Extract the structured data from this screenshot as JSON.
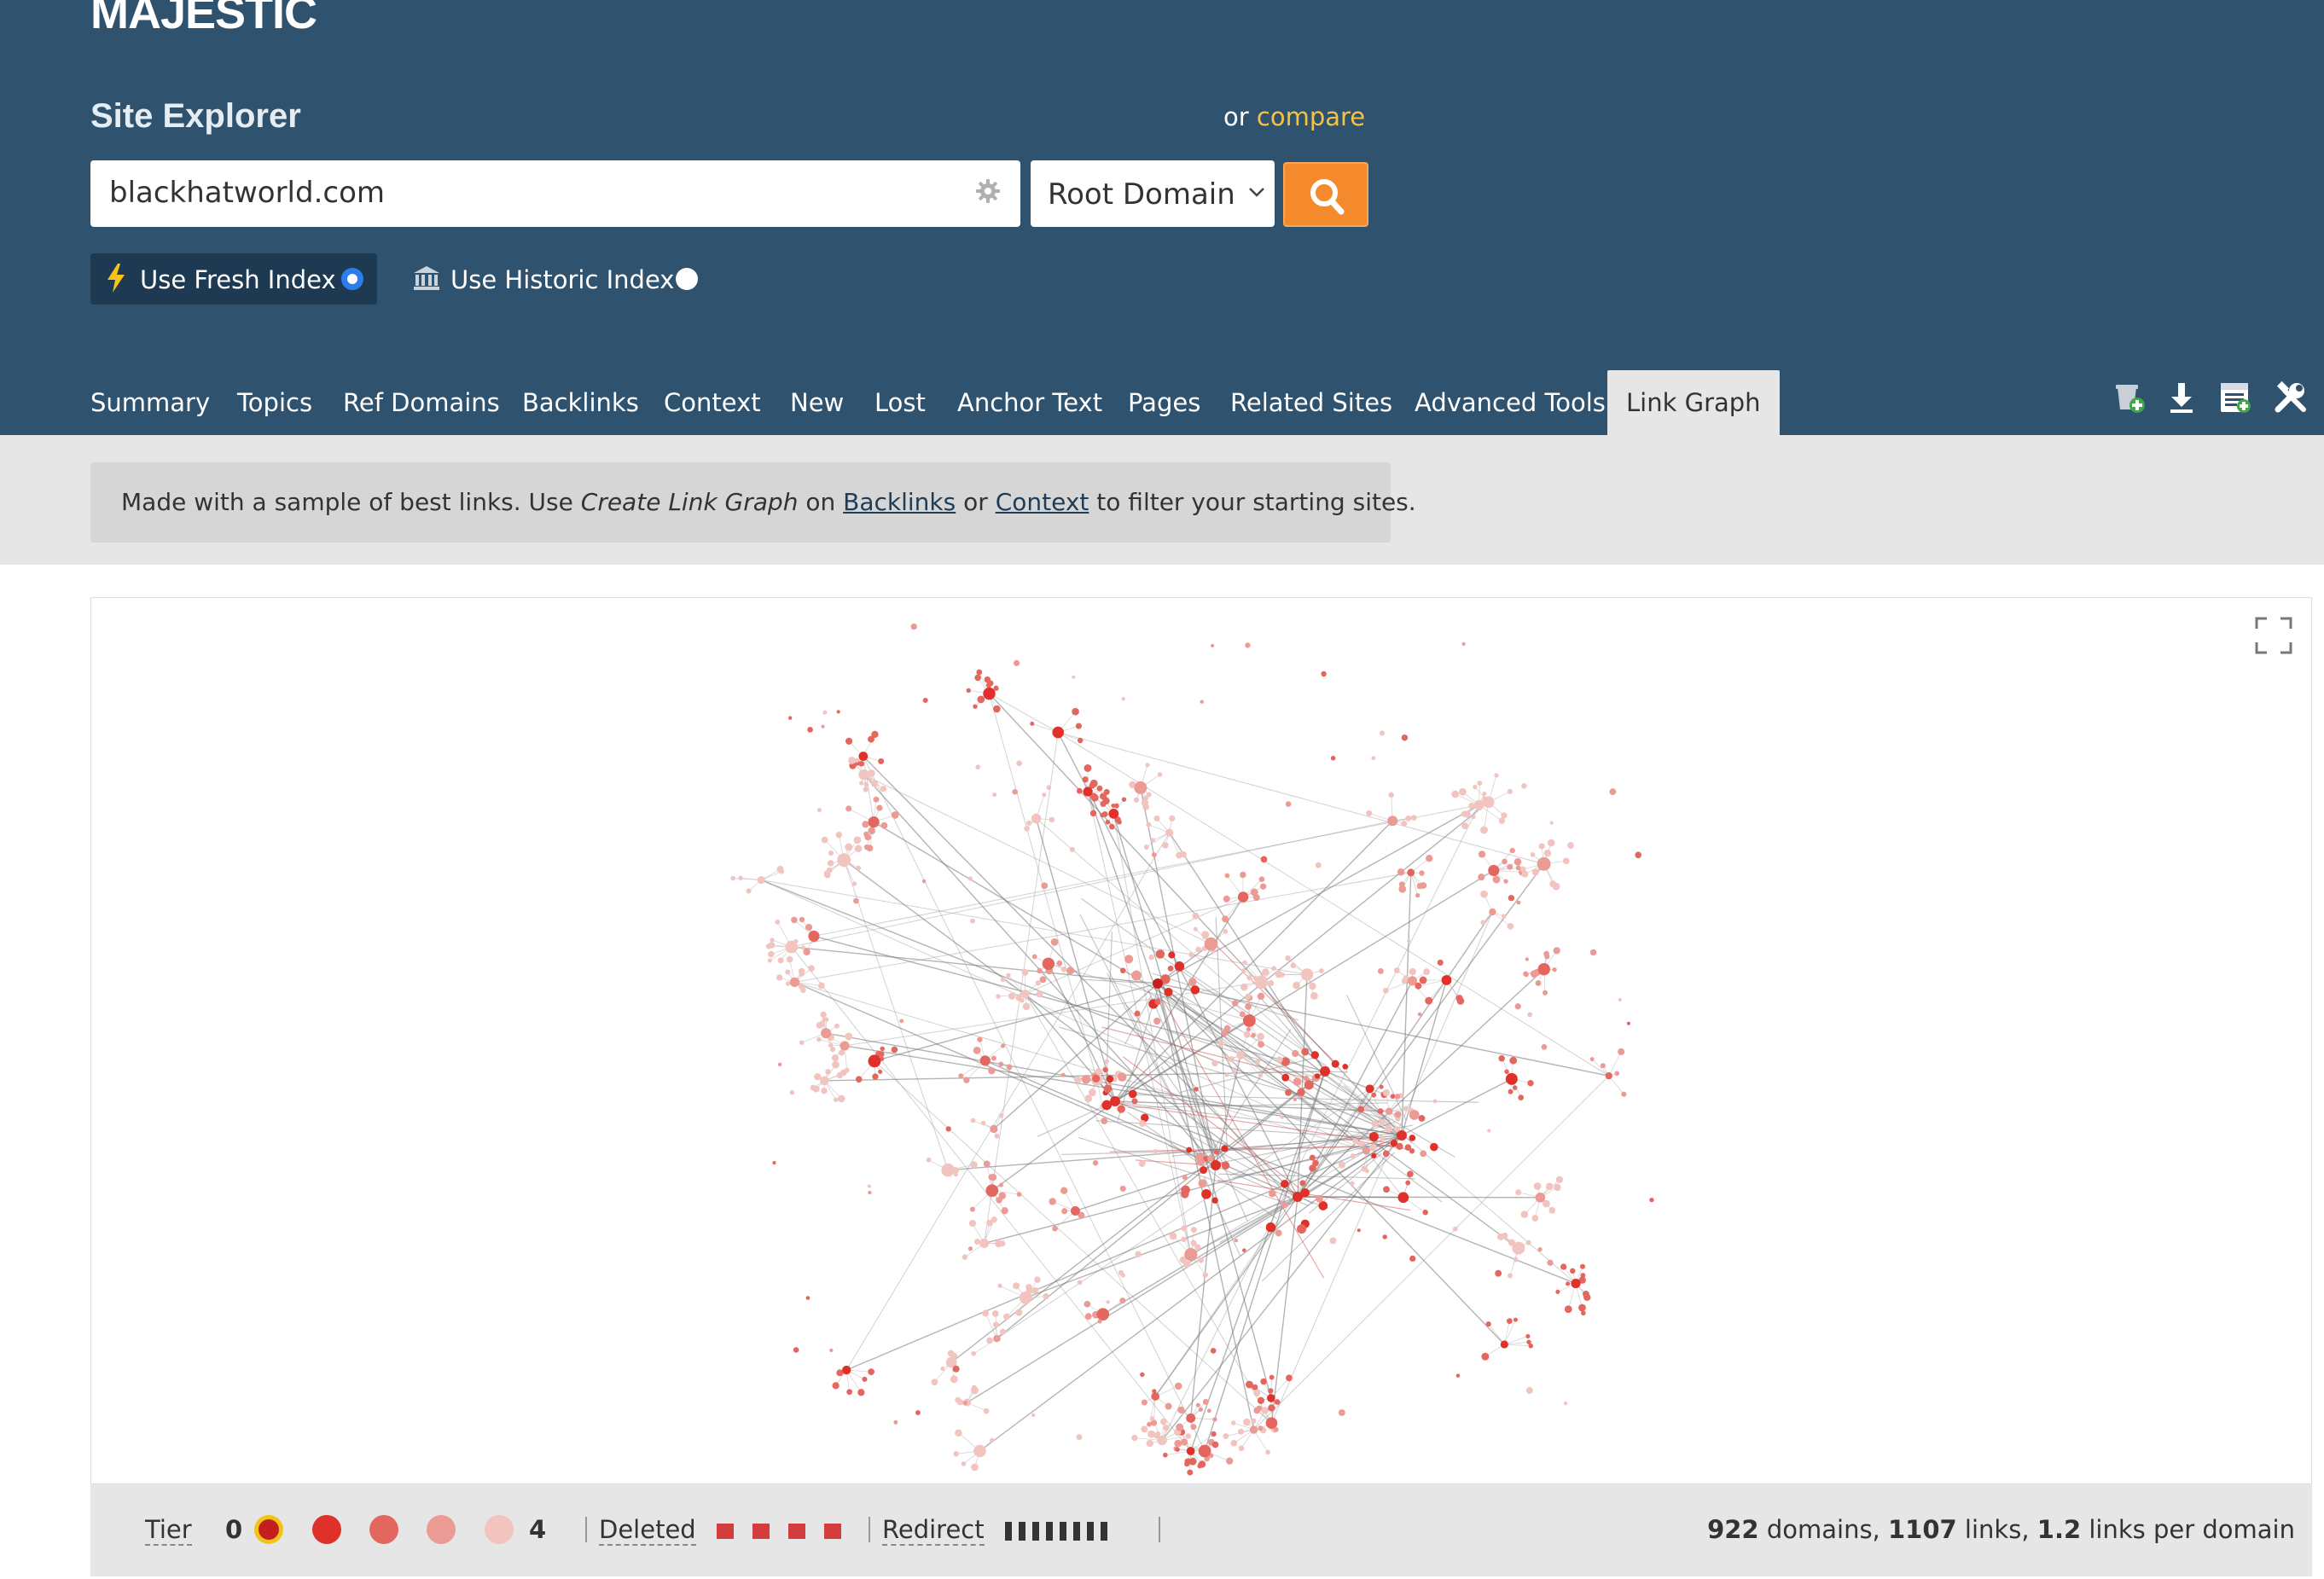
{
  "brand": {
    "logo": "MAJESTIC"
  },
  "site_explorer": {
    "title": "Site Explorer",
    "compare_prefix": "or",
    "compare_link": "compare",
    "search_value": "blackhatworld.com",
    "scope_selected": "Root Domain",
    "fresh_index_label": "Use Fresh Index",
    "historic_index_label": "Use Historic Index",
    "fresh_index_selected": true
  },
  "tabs": [
    {
      "label": "Summary"
    },
    {
      "label": "Topics"
    },
    {
      "label": "Ref Domains"
    },
    {
      "label": "Backlinks"
    },
    {
      "label": "Context"
    },
    {
      "label": "New"
    },
    {
      "label": "Lost"
    },
    {
      "label": "Anchor Text"
    },
    {
      "label": "Pages"
    },
    {
      "label": "Related Sites"
    },
    {
      "label": "Advanced Tools"
    },
    {
      "label": "Link Graph",
      "active": true
    }
  ],
  "toolbar_icons": [
    "add-to-bucket-icon",
    "download-icon",
    "report-icon",
    "tools-icon"
  ],
  "notice": {
    "text_1": "Made with a sample of best links. Use ",
    "text_em": "Create Link Graph",
    "text_2": " on ",
    "link_backlinks": "Backlinks",
    "text_3": " or ",
    "link_context": "Context",
    "text_4": " to filter your starting sites."
  },
  "legend": {
    "tier_label": "Tier",
    "tier_min": "0",
    "tier_max": "4",
    "deleted_label": "Deleted",
    "redirect_label": "Redirect",
    "tier_colors": [
      "#c41e1e",
      "#e0302a",
      "#e4675f",
      "#ec9a94",
      "#f2c4c0"
    ],
    "tier0_ring": "#f2c418"
  },
  "stats": {
    "domains": "922",
    "domains_label": " domains, ",
    "links": "1107",
    "links_label": " links, ",
    "ratio": "1.2",
    "ratio_label": " links per domain"
  },
  "colors": {
    "header": "#2f536f",
    "search_button": "#f58a2c",
    "compare": "#f5c242",
    "node": "#e0302a",
    "edge": "#888888"
  }
}
